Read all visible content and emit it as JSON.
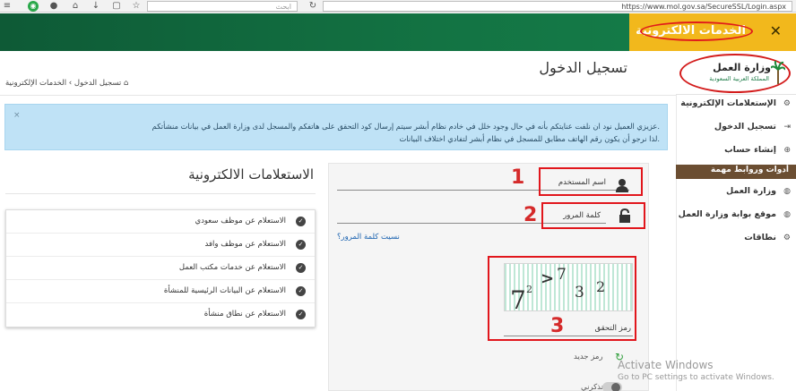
{
  "browser": {
    "search_placeholder": "ابحث",
    "url": "https://www.mol.gov.sa/SecureSSL/Login.aspx"
  },
  "header": {
    "banner_title": "الخدمات الالكترونية",
    "close_icon": "close-icon",
    "brand_green": "#137343",
    "accent_orange": "#f2b81c",
    "annotation_red": "#e1161c"
  },
  "logo": {
    "title": "وزارة العمل",
    "subtitle": "المملكة العربية السعودية"
  },
  "sidebar": {
    "items": [
      {
        "label": "الإستعلامات الإلكترونية",
        "icon": "gears-icon"
      },
      {
        "label": "تسجيل الدخول",
        "icon": "login-icon"
      },
      {
        "label": "إنشاء حساب",
        "icon": "plus-icon"
      }
    ],
    "section_header": "أدوات وروابط مهمة",
    "links": [
      {
        "label": "وزارة العمل",
        "icon": "globe-icon"
      },
      {
        "label": "موقع بوابة وزارة العمل",
        "icon": "globe-icon"
      },
      {
        "label": "نطاقات",
        "icon": "gear-icon"
      }
    ]
  },
  "page": {
    "title": "تسجيل الدخول",
    "breadcrumb_home": "الخدمات الإلكترونية",
    "breadcrumb_sep": "›",
    "breadcrumb_current": "تسجيل الدخول"
  },
  "alert": {
    "line1": "عزيزي العميل نود ان نلفت عنايتكم بأنه في حال وجود خلل في خادم نظام أبشر سيتم إرسال كود التحقق على هاتفكم والمسجل لدى وزارة العمل في بيانات منشأتكم.",
    "line2": "لذا نرجو أن يكون رقم الهاتف مطابق للمسجل في نظام أبشر لتفادي اختلاف البيانات.",
    "close": "×"
  },
  "inquiries": {
    "title": "الاستعلامات الالكترونية",
    "items": [
      "الاستعلام عن موظف سعودي",
      "الاستعلام عن موظف وافد",
      "الاستعلام عن خدمات مكتب العمل",
      "الاستعلام عن البيانات الرئيسية للمنشأة",
      "الاستعلام عن نطاق منشأة"
    ]
  },
  "login": {
    "username_label": "اسم المستخدم",
    "password_label": "كلمة المرور",
    "forgot_password": "نسيت كلمة المرور؟",
    "captcha_label": "رمز التحقق",
    "new_code": "رمز جديد",
    "remember_me": "تذكرني",
    "annotations": [
      "1",
      "2",
      "3"
    ]
  },
  "captcha": {
    "chars": [
      "7",
      "2",
      ">",
      "7",
      "3",
      "2"
    ]
  },
  "watermark": {
    "line1": "Activate Windows",
    "line2": "Go to PC settings to activate Windows."
  }
}
